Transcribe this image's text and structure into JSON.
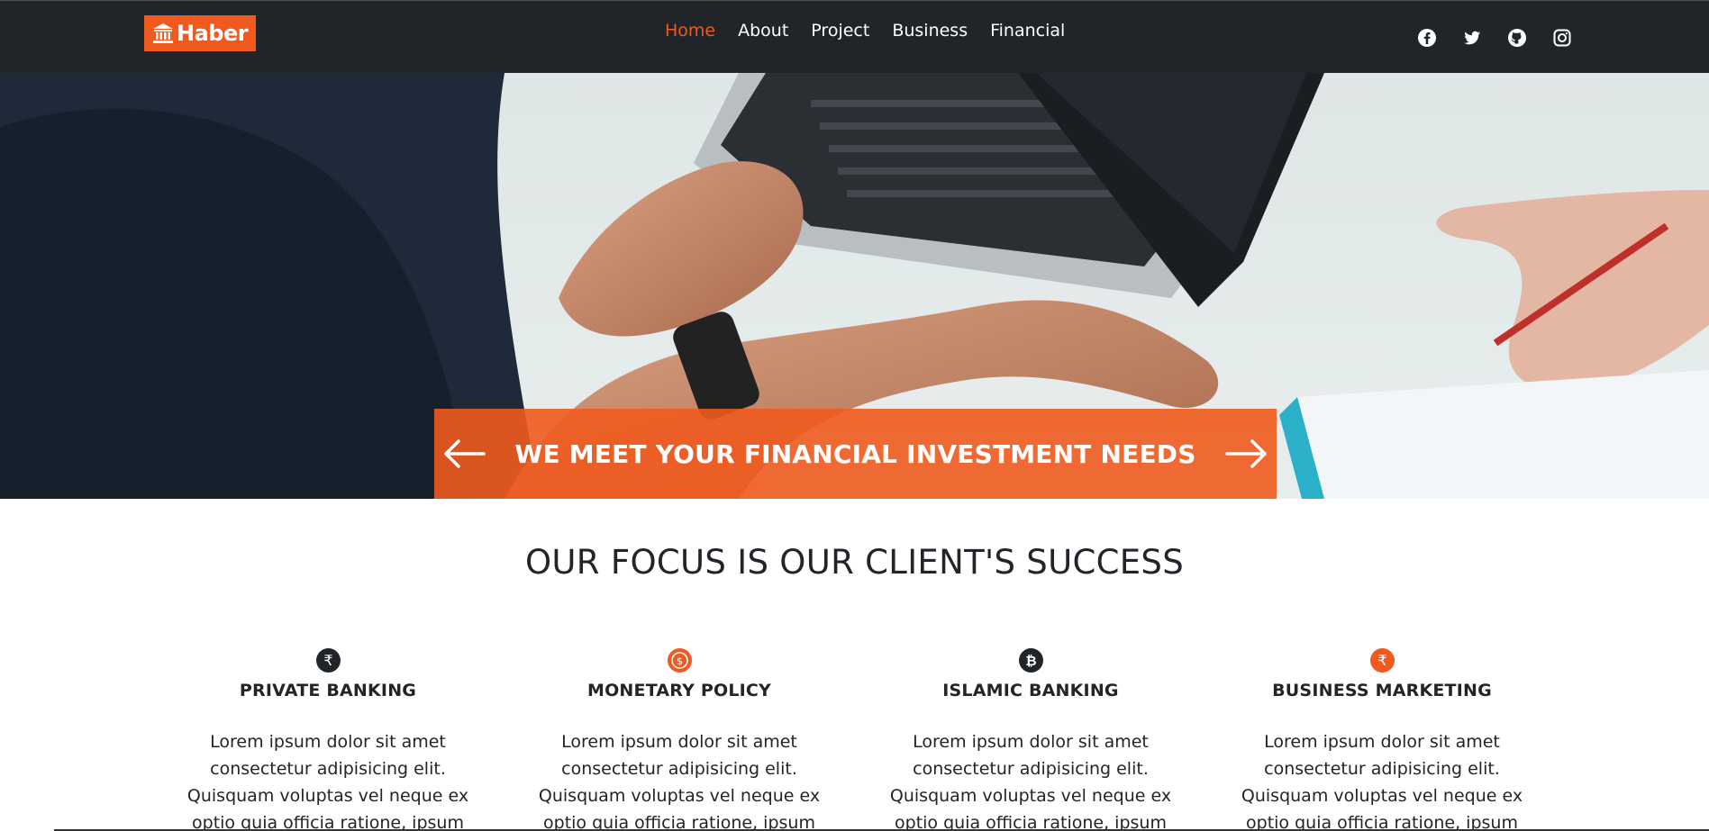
{
  "brand": {
    "name": "Haber",
    "icon": "bank-icon",
    "color": "#f05a1e"
  },
  "nav": {
    "items": [
      {
        "label": "Home",
        "active": true
      },
      {
        "label": "About",
        "active": false
      },
      {
        "label": "Project",
        "active": false
      },
      {
        "label": "Business",
        "active": false
      },
      {
        "label": "Financial",
        "active": false
      }
    ]
  },
  "social": [
    "facebook-icon",
    "twitter-icon",
    "github-icon",
    "instagram-icon"
  ],
  "hero": {
    "banner_title": "WE MEET YOUR FINANCIAL INVESTMENT NEEDS",
    "prev_icon": "arrow-left-icon",
    "next_icon": "arrow-right-icon"
  },
  "focus": {
    "title": "OUR FOCUS IS OUR CLIENT'S SUCCESS",
    "cards": [
      {
        "icon": "rupee-icon",
        "title": "PRIVATE BANKING",
        "text": "Lorem ipsum dolor sit amet consectetur adipisicing elit. Quisquam voluptas vel neque ex optio quia officia ratione, ipsum earum saepe."
      },
      {
        "icon": "coin-dollar-icon",
        "title": "MONETARY POLICY",
        "text": "Lorem ipsum dolor sit amet consectetur adipisicing elit. Quisquam voluptas vel neque ex optio quia officia ratione, ipsum earum saepe."
      },
      {
        "icon": "bitcoin-icon",
        "title": "ISLAMIC BANKING",
        "text": "Lorem ipsum dolor sit amet consectetur adipisicing elit. Quisquam voluptas vel neque ex optio quia officia ratione, ipsum earum saepe."
      },
      {
        "icon": "rupee-icon",
        "title": "BUSINESS MARKETING",
        "text": "Lorem ipsum dolor sit amet consectetur adipisicing elit. Quisquam voluptas vel neque ex optio quia officia ratione, ipsum earum saepe."
      }
    ]
  },
  "colors": {
    "navbar": "#212529",
    "accent": "#f05a1e",
    "text": "#212529"
  }
}
